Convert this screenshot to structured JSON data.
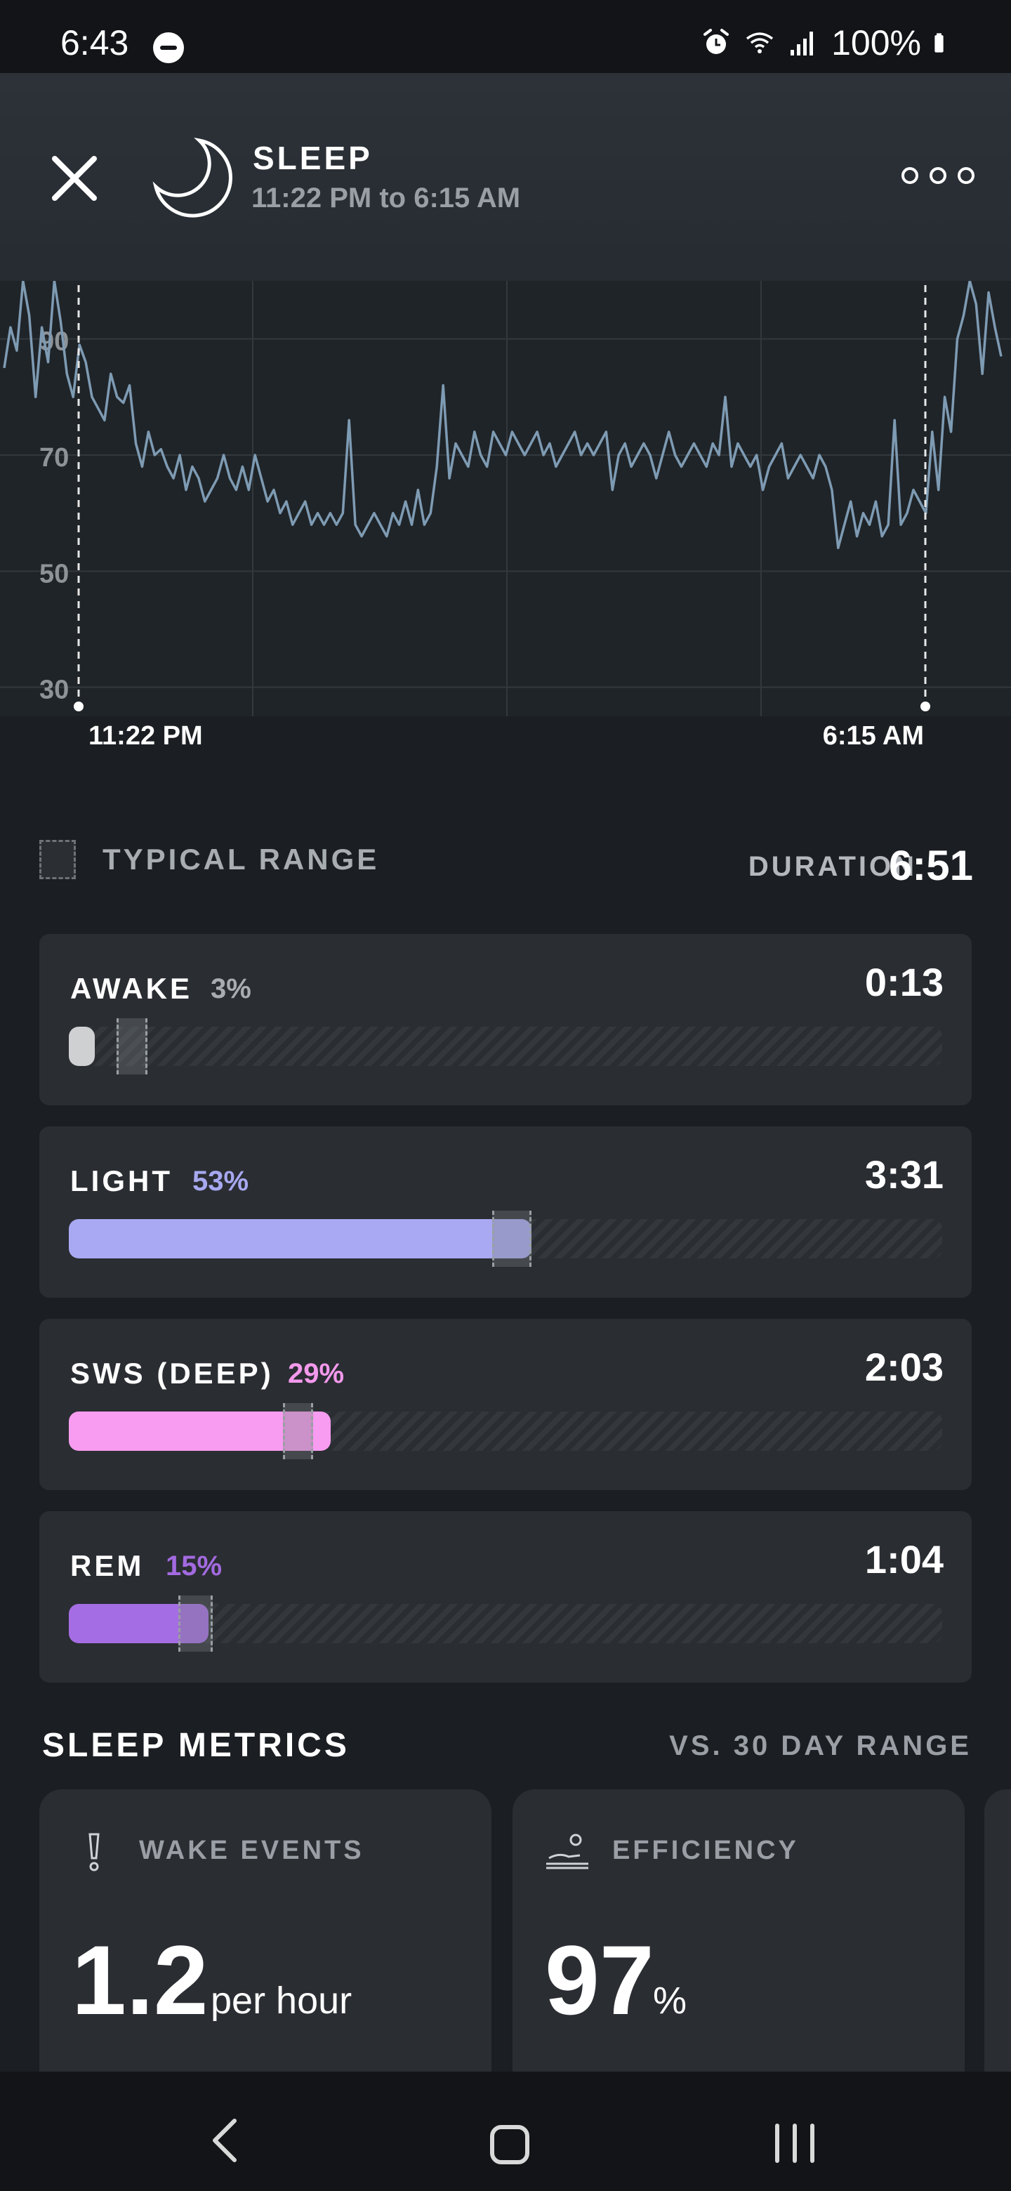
{
  "status_bar": {
    "time": "6:43",
    "battery": "100%",
    "icons": [
      "do-not-disturb-icon",
      "alarm-icon",
      "wifi-icon",
      "signal-icon",
      "battery-icon"
    ]
  },
  "header": {
    "title": "SLEEP",
    "subtitle": "11:22 PM to 6:15 AM",
    "icons": [
      "close-icon",
      "moon-icon",
      "more-icon"
    ]
  },
  "chart_data": {
    "type": "line",
    "ylim": [
      25,
      100
    ],
    "yticks": [
      30,
      50,
      70,
      90
    ],
    "ytick_labels": [
      "30",
      "50",
      "70",
      "90"
    ],
    "start_label": "11:22 PM",
    "end_label": "6:15 AM",
    "grid": true,
    "series": [
      {
        "values": [
          85,
          92,
          88,
          100,
          94,
          80,
          92,
          86,
          100,
          93,
          84,
          80,
          89,
          86,
          80,
          78,
          76,
          84,
          80,
          79,
          82,
          72,
          68,
          74,
          70,
          71,
          68,
          66,
          70,
          64,
          68,
          66,
          62,
          64,
          66,
          70,
          66,
          64,
          68,
          64,
          70,
          66,
          62,
          64,
          60,
          62,
          58,
          60,
          62,
          58,
          60,
          58,
          60,
          58,
          60,
          76,
          58,
          56,
          58,
          60,
          58,
          56,
          60,
          58,
          62,
          58,
          64,
          58,
          60,
          68,
          82,
          66,
          72,
          70,
          68,
          74,
          70,
          68,
          74,
          72,
          70,
          74,
          72,
          70,
          72,
          74,
          70,
          72,
          68,
          70,
          72,
          74,
          70,
          72,
          70,
          72,
          74,
          64,
          70,
          72,
          68,
          70,
          72,
          70,
          66,
          70,
          74,
          70,
          68,
          70,
          72,
          70,
          68,
          72,
          70,
          80,
          68,
          72,
          70,
          68,
          70,
          64,
          68,
          70,
          72,
          66,
          68,
          70,
          68,
          66,
          70,
          68,
          64,
          54,
          58,
          62,
          56,
          60,
          58,
          62,
          56,
          58,
          76,
          58,
          60,
          64,
          62,
          60,
          74,
          64,
          80,
          74,
          90,
          94,
          100,
          96,
          84,
          98,
          92,
          87
        ]
      }
    ]
  },
  "typical_range": {
    "label": "TYPICAL RANGE"
  },
  "duration": {
    "label": "DURATION",
    "value": "6:51"
  },
  "stages": [
    {
      "name": "AWAKE",
      "percent": "3%",
      "time": "0:13",
      "fill": 0.03,
      "typical": [
        0.055,
        0.09
      ],
      "color": "#cfd0d2",
      "pct_color": "#a8adb2"
    },
    {
      "name": "LIGHT",
      "percent": "53%",
      "time": "3:31",
      "fill": 0.53,
      "typical": [
        0.485,
        0.53
      ],
      "color": "#a9a9f3",
      "pct_color": "#a7a8f0"
    },
    {
      "name": "SWS (DEEP)",
      "percent": "29%",
      "time": "2:03",
      "fill": 0.3,
      "typical": [
        0.245,
        0.28
      ],
      "color": "#f79cf0",
      "pct_color": "#f399ec"
    },
    {
      "name": "REM",
      "percent": "15%",
      "time": "1:04",
      "fill": 0.16,
      "typical": [
        0.125,
        0.165
      ],
      "color": "#a56de3",
      "pct_color": "#a36ae0"
    }
  ],
  "sleep_metrics": {
    "title": "SLEEP METRICS",
    "compare_label": "VS. 30 DAY RANGE",
    "cards": [
      {
        "label": "WAKE EVENTS",
        "value": "1.2",
        "unit": "per hour",
        "icon": "exclamation-icon"
      },
      {
        "label": "EFFICIENCY",
        "value": "97",
        "unit": "%",
        "icon": "sleeping-person-icon"
      }
    ]
  },
  "nav_bar": {
    "icons": [
      "back-icon",
      "home-icon",
      "recents-icon"
    ]
  }
}
